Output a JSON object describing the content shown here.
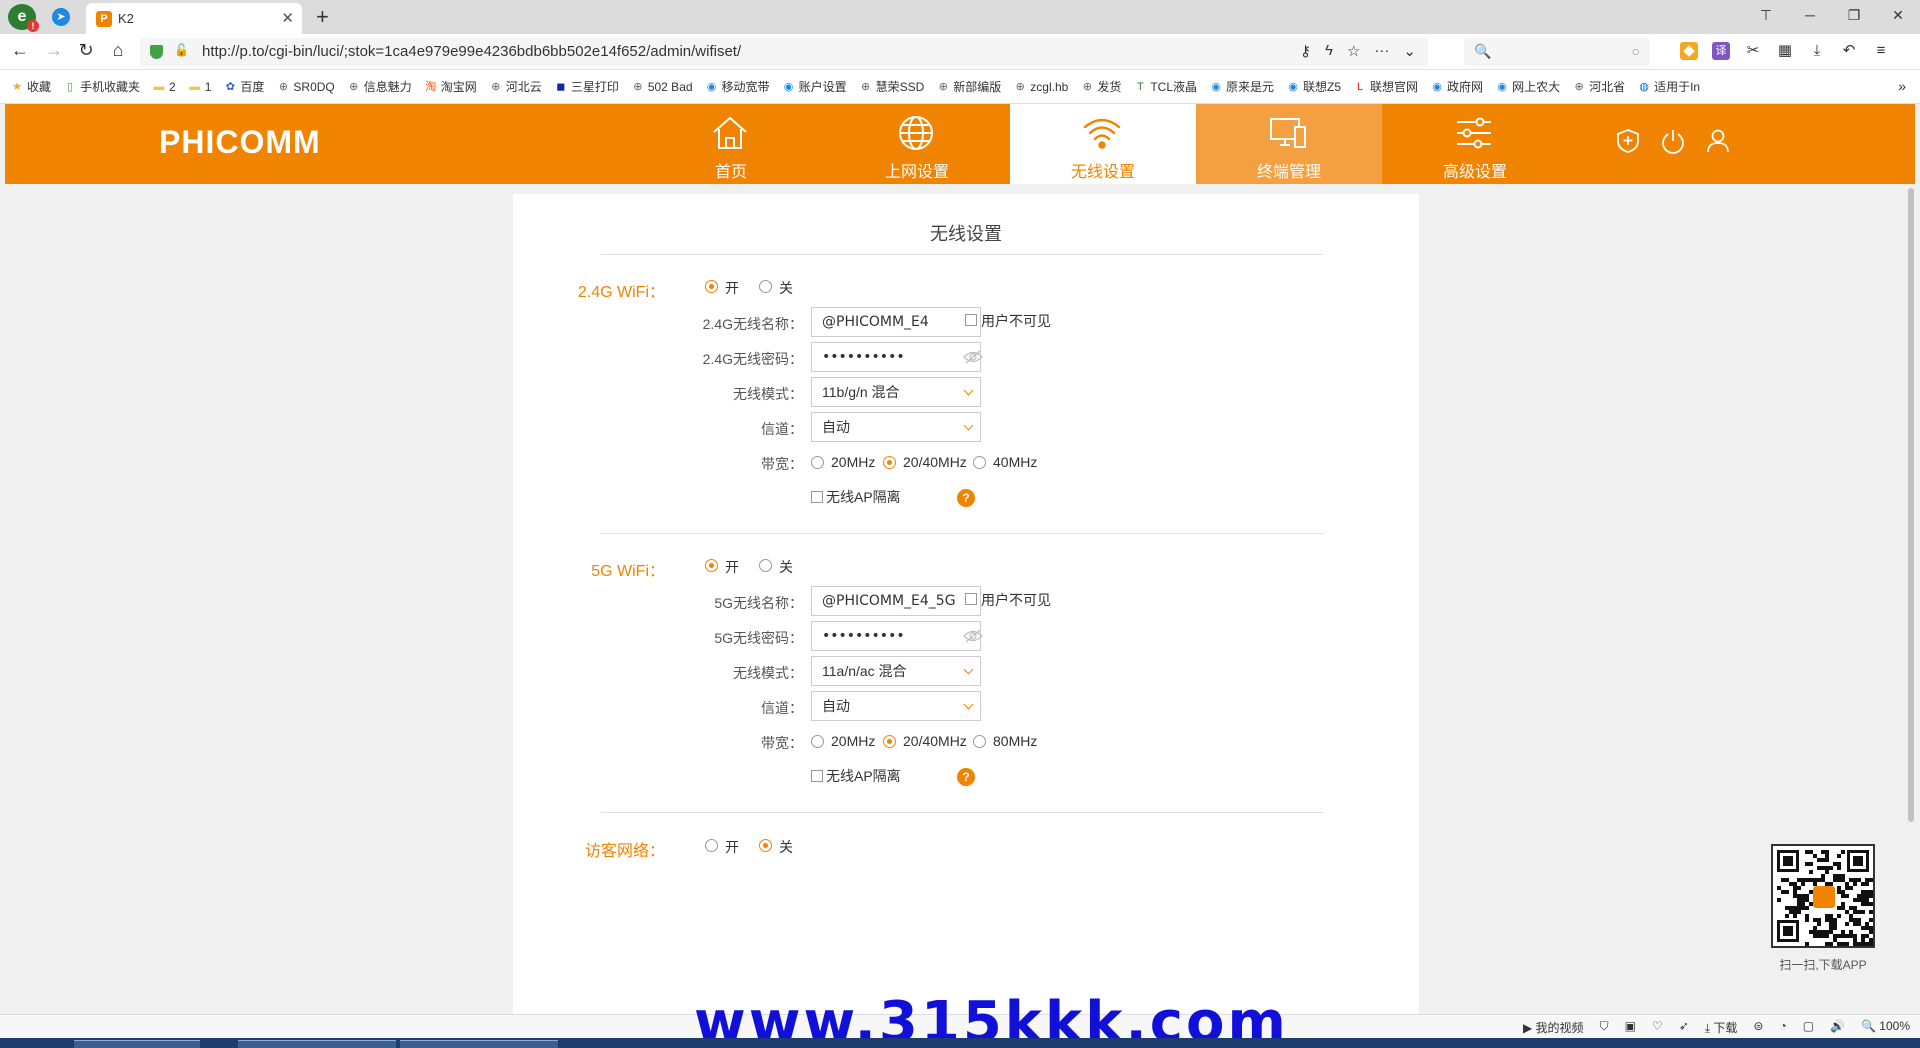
{
  "browser": {
    "tab_title": "K2",
    "tab_favicon": "P",
    "url": "http://p.to/cgi-bin/luci/;stok=1ca4e979e99e4236bdb6bb502e14f652/admin/wifiset/",
    "search_placeholder": "",
    "bookmarks": [
      {
        "icon": "star-icon",
        "label": "收藏"
      },
      {
        "icon": "phone-icon",
        "label": "手机收藏夹"
      },
      {
        "icon": "folder-icon",
        "label": "2"
      },
      {
        "icon": "folder-icon",
        "label": "1"
      },
      {
        "icon": "paw-icon",
        "label": "百度"
      },
      {
        "icon": "globe-icon",
        "label": "SR0DQ"
      },
      {
        "icon": "globe-icon",
        "label": "信息魅力"
      },
      {
        "icon": "taobao-icon",
        "label": "淘宝网"
      },
      {
        "icon": "globe-icon",
        "label": "河北云"
      },
      {
        "icon": "samsung-icon",
        "label": "三星打印"
      },
      {
        "icon": "globe-icon",
        "label": "502 Bad"
      },
      {
        "icon": "site-icon",
        "label": "移动宽带"
      },
      {
        "icon": "site-icon",
        "label": "账户设置"
      },
      {
        "icon": "globe-icon",
        "label": "慧荣SSD"
      },
      {
        "icon": "globe-icon",
        "label": "新部编版"
      },
      {
        "icon": "globe-icon",
        "label": "zcgl.hb"
      },
      {
        "icon": "globe-icon",
        "label": "发货"
      },
      {
        "icon": "tcl-icon",
        "label": "TCL液晶"
      },
      {
        "icon": "site-icon",
        "label": "原来是元"
      },
      {
        "icon": "site-icon",
        "label": "联想Z5"
      },
      {
        "icon": "lenovo-icon",
        "label": "联想官网"
      },
      {
        "icon": "site-icon",
        "label": "政府网"
      },
      {
        "icon": "site-icon",
        "label": "网上农大"
      },
      {
        "icon": "globe-icon",
        "label": "河北省"
      },
      {
        "icon": "dell-icon",
        "label": "适用于In"
      }
    ],
    "zoom": "100%",
    "status_items": [
      "我的视频",
      "下载",
      "100%"
    ]
  },
  "router": {
    "brand": "PHICOMM",
    "nav": [
      {
        "label": "首页",
        "icon": "home-icon"
      },
      {
        "label": "上网设置",
        "icon": "globe-icon"
      },
      {
        "label": "无线设置",
        "icon": "wifi-icon"
      },
      {
        "label": "终端管理",
        "icon": "devices-icon"
      },
      {
        "label": "高级设置",
        "icon": "sliders-icon"
      }
    ],
    "page_title": "无线设置",
    "wifi24": {
      "label": "2.4G WiFi：",
      "on_label": "开",
      "off_label": "关",
      "enabled": true,
      "ssid_label": "2.4G无线名称：",
      "ssid": "@PHICOMM_E4",
      "hidden_label": "用户不可见",
      "password_label": "2.4G无线密码：",
      "password": "••••••••••",
      "mode_label": "无线模式：",
      "mode": "11b/g/n 混合",
      "channel_label": "信道：",
      "channel": "自动",
      "bandwidth_label": "带宽：",
      "bandwidth_options": [
        "20MHz",
        "20/40MHz",
        "40MHz"
      ],
      "bandwidth_selected": "20/40MHz",
      "ap_isolation_label": "无线AP隔离"
    },
    "wifi5": {
      "label": "5G WiFi：",
      "on_label": "开",
      "off_label": "关",
      "enabled": true,
      "ssid_label": "5G无线名称：",
      "ssid": "@PHICOMM_E4_5G",
      "hidden_label": "用户不可见",
      "password_label": "5G无线密码：",
      "password": "••••••••••",
      "mode_label": "无线模式：",
      "mode": "11a/n/ac 混合",
      "channel_label": "信道：",
      "channel": "自动",
      "bandwidth_label": "带宽：",
      "bandwidth_options": [
        "20MHz",
        "20/40MHz",
        "80MHz"
      ],
      "bandwidth_selected": "20/40MHz",
      "ap_isolation_label": "无线AP隔离"
    },
    "guest": {
      "label": "访客网络：",
      "on_label": "开",
      "off_label": "关",
      "enabled": false
    },
    "qr_caption": "扫一扫,下载APP",
    "accent_color": "#f08300"
  },
  "watermark": "www.315kkk.com"
}
